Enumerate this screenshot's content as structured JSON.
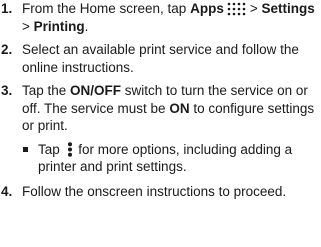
{
  "steps": [
    {
      "number": "1.",
      "text_1": "From the Home screen, tap ",
      "apps_label": "Apps",
      "arrow_1": ">",
      "settings_label": "Settings",
      "sep": " > ",
      "printing_label": "Printing",
      "end": "."
    },
    {
      "number": "2.",
      "text": "Select an available print service and follow the online instructions."
    },
    {
      "number": "3.",
      "text_1": "Tap the ",
      "onoff_label": "ON/OFF",
      "text_2": " switch to turn the service on or off. The service must be ",
      "on_label": "ON",
      "text_3": " to configure settings or print."
    },
    {
      "number": "4.",
      "text": "Follow the onscreen instructions to proceed."
    }
  ],
  "sub_bullet": {
    "text_1": "Tap ",
    "text_2": " for more options, including adding a printer and print settings."
  },
  "icons": {
    "apps": "apps-grid-icon",
    "menu": "more-options-icon"
  },
  "colors": {
    "text": "#1a1a1a"
  }
}
